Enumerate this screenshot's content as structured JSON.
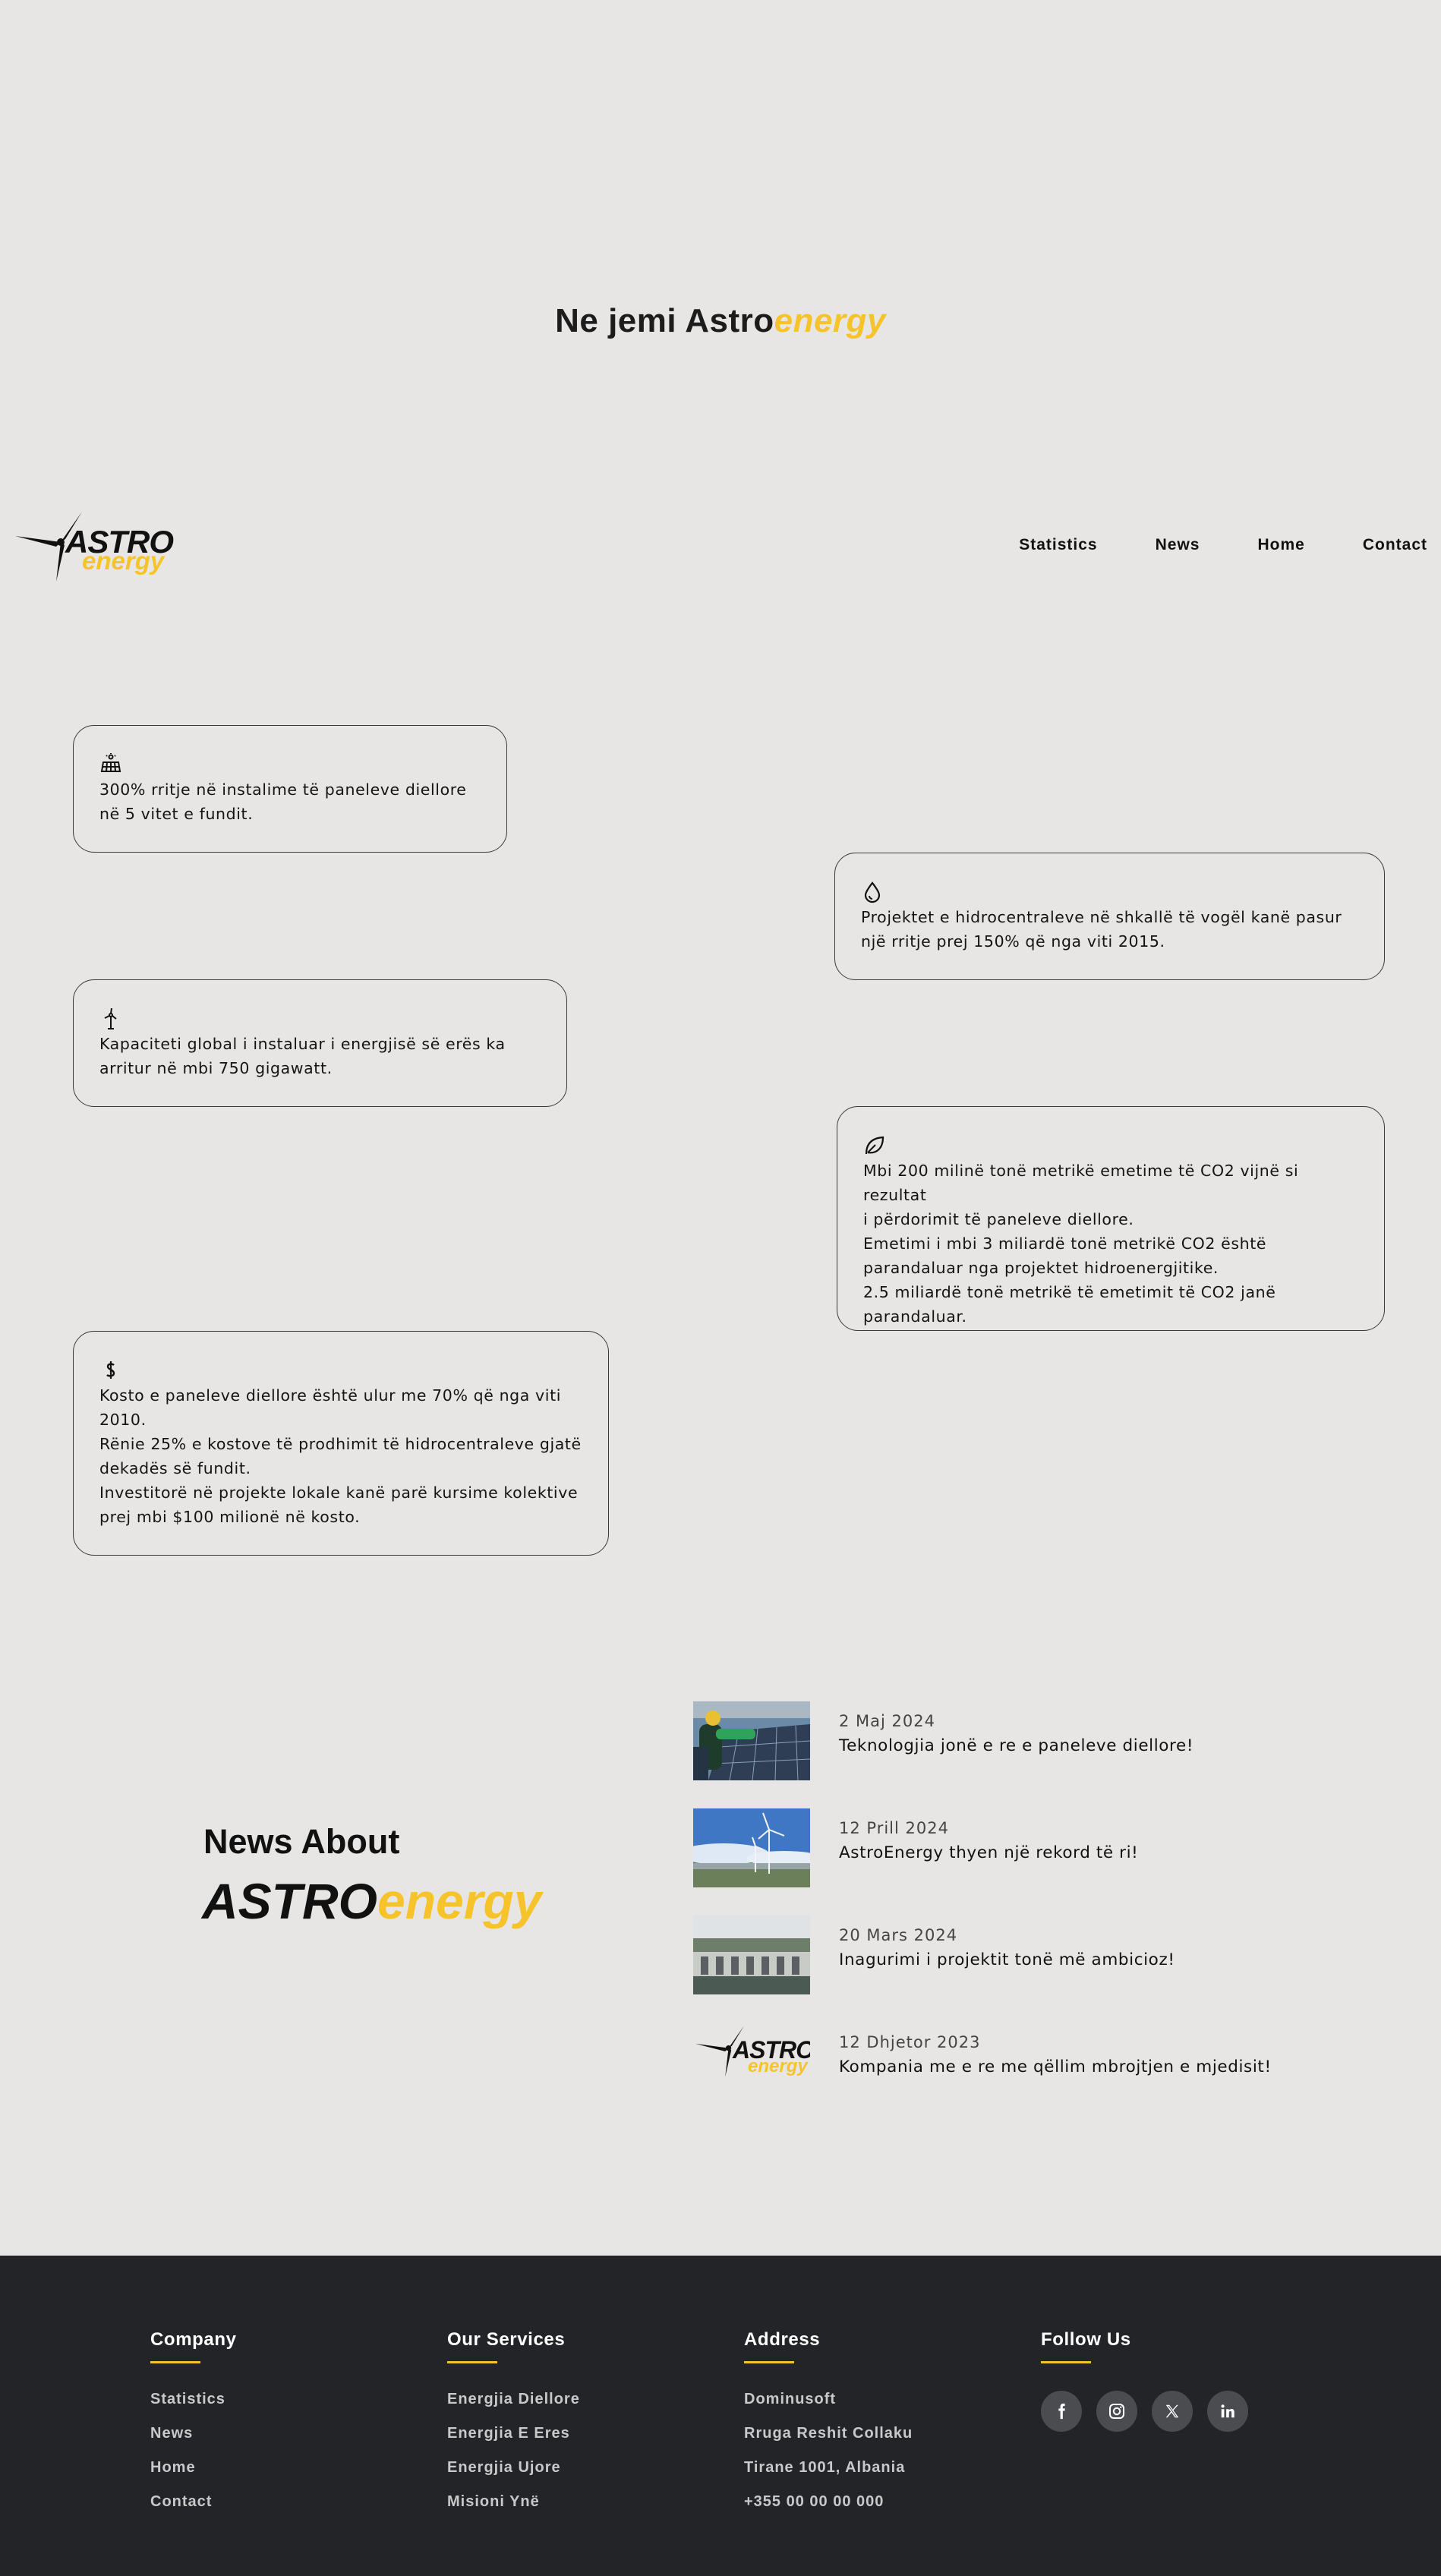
{
  "hero": {
    "title_prefix": "Ne jemi Astro",
    "title_accent": "energy"
  },
  "brand": {
    "astro": "ASTRO",
    "energy": "energy"
  },
  "nav": {
    "items": [
      "Statistics",
      "News",
      "Home",
      "Contact"
    ]
  },
  "stats": [
    {
      "icon": "solar-panel-icon",
      "lines": [
        "300% rritje në instalime të paneleve diellore",
        "në 5 vitet e fundit."
      ]
    },
    {
      "icon": "water-drop-icon",
      "lines": [
        "Projektet e hidrocentraleve në shkallë të vogël kanë pasur",
        "një rritje prej 150% që nga viti 2015."
      ]
    },
    {
      "icon": "wind-turbine-icon",
      "lines": [
        "Kapaciteti global i instaluar i energjisë së erës ka",
        "arritur në mbi 750 gigawatt."
      ]
    },
    {
      "icon": "leaf-icon",
      "lines": [
        "Mbi 200 milinë tonë metrikë emetime të CO2 vijnë si rezultat",
        "i përdorimit të paneleve diellore.",
        "Emetimi i mbi 3 miliardë tonë metrikë CO2 është",
        "parandaluar nga projektet hidroenergjitike.",
        "2.5 miliardë tonë metrikë të emetimit të CO2 janë",
        "parandaluar."
      ]
    },
    {
      "icon": "dollar-icon",
      "lines": [
        "Kosto e paneleve diellore është ulur me 70% që nga viti",
        "2010.",
        "Rënie 25% e kostove të prodhimit të hidrocentraleve gjatë",
        "dekadës së fundit.",
        "Investitorë në projekte lokale kanë parë kursime kolektive",
        "prej mbi $100 milionë në kosto."
      ]
    }
  ],
  "news": {
    "heading": "News About",
    "brand_astro": "ASTRO",
    "brand_energy": "energy",
    "items": [
      {
        "date": "2 Maj 2024",
        "title": "Teknologjia jonë e re e paneleve diellore!"
      },
      {
        "date": "12 Prill 2024",
        "title": "AstroEnergy thyen një rekord të ri!"
      },
      {
        "date": "20 Mars 2024",
        "title": "Inagurimi i projektit tonë më ambicioz!"
      },
      {
        "date": "12 Dhjetor 2023",
        "title": "Kompania me e re me qëllim mbrojtjen e mjedisit!"
      }
    ]
  },
  "footer": {
    "company": {
      "title": "Company",
      "items": [
        "Statistics",
        "News",
        "Home",
        "Contact"
      ]
    },
    "services": {
      "title": "Our Services",
      "items": [
        "Energjia Diellore",
        "Energjia E Eres",
        "Energjia Ujore",
        "Misioni Ynë"
      ]
    },
    "address": {
      "title": "Address",
      "items": [
        "Dominusoft",
        "Rruga Reshit Collaku",
        "Tirane 1001, Albania",
        "+355 00 00 00 000"
      ]
    },
    "follow": {
      "title": "Follow Us",
      "icons": [
        "facebook-icon",
        "instagram-icon",
        "x-icon",
        "linkedin-icon"
      ]
    }
  },
  "colors": {
    "accent": "#f6c32b",
    "background": "#e8e6e4",
    "footer_bg": "#232427",
    "social_btn": "#4b4c50"
  }
}
